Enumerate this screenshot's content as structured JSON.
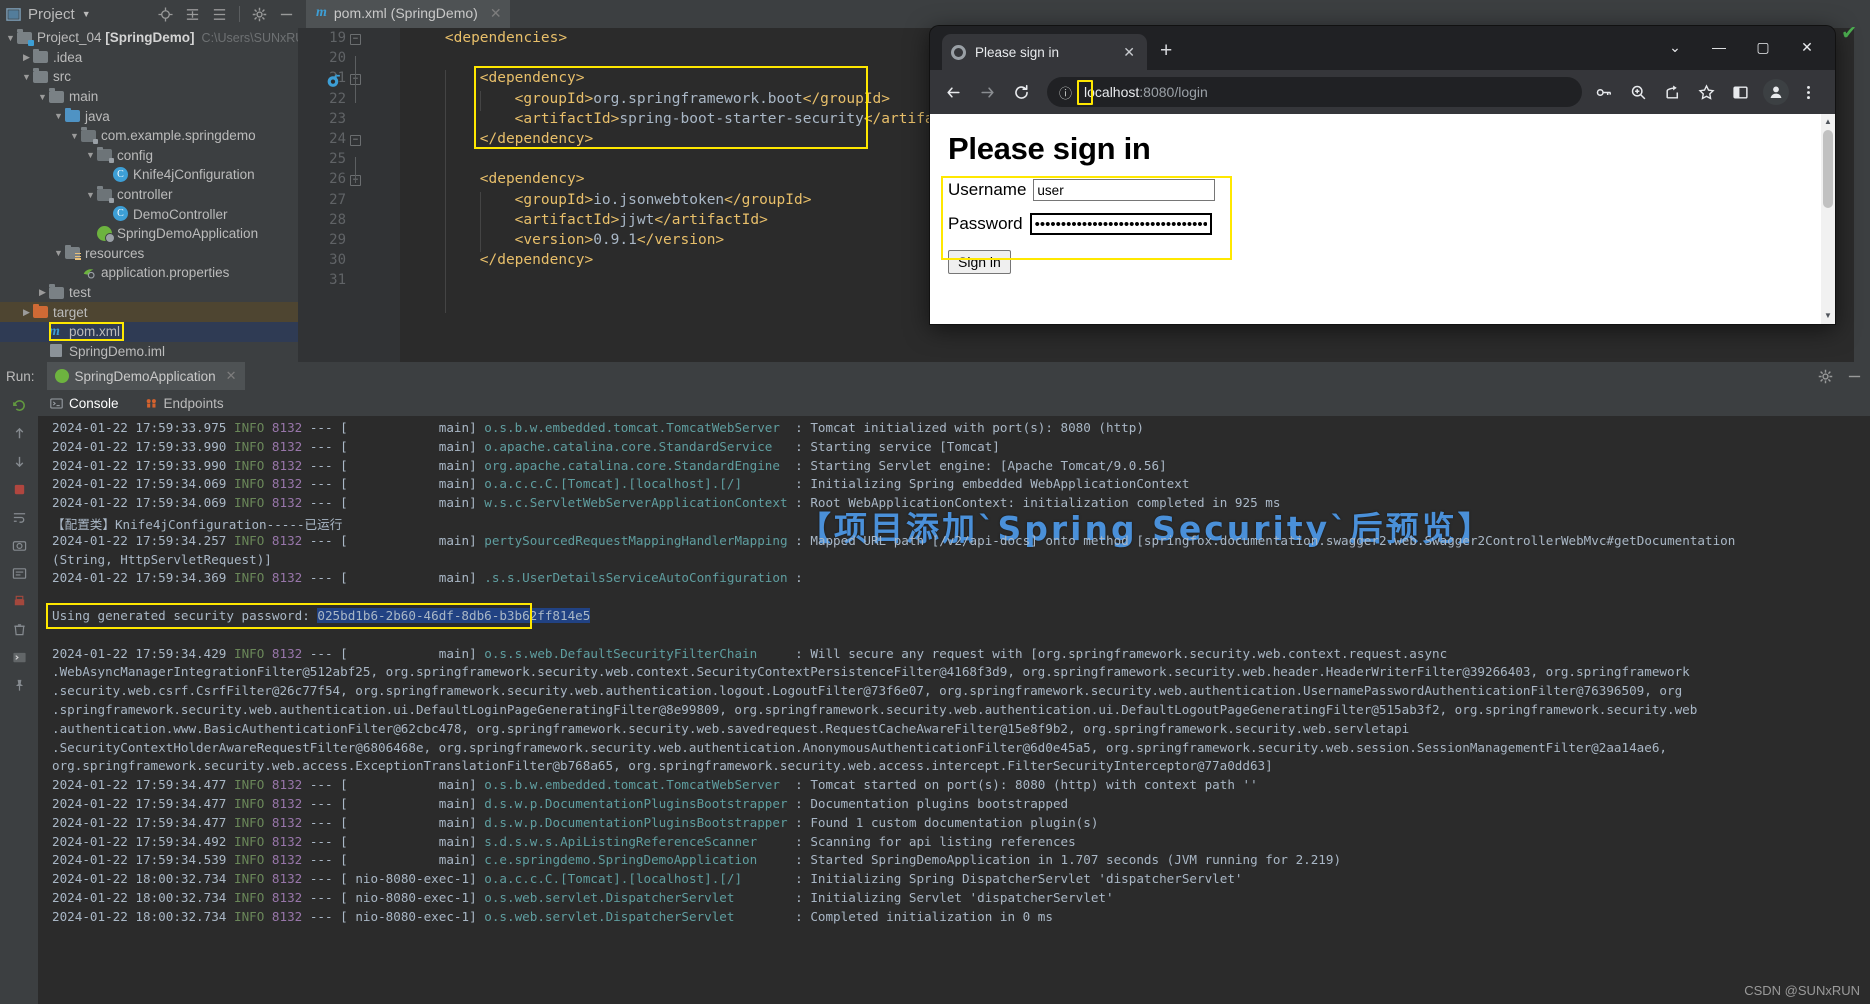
{
  "ide": {
    "project_panel": {
      "title": "Project",
      "caret": "▼",
      "icons": [
        "locate-icon",
        "expand-all-icon",
        "collapse-all-icon",
        "settings-icon",
        "minimize-icon"
      ]
    },
    "tree": [
      {
        "indent": 0,
        "arrow": "v",
        "icon": "module-folder",
        "label": "Project_04 ",
        "bold": "[SpringDemo]",
        "dim": "C:\\Users\\SUNxRUI"
      },
      {
        "indent": 1,
        "arrow": ">",
        "icon": "folder",
        "label": ".idea",
        "bold": "",
        "dim": ""
      },
      {
        "indent": 1,
        "arrow": "v",
        "icon": "folder",
        "label": "src",
        "bold": "",
        "dim": ""
      },
      {
        "indent": 2,
        "arrow": "v",
        "icon": "folder",
        "label": "main",
        "bold": "",
        "dim": ""
      },
      {
        "indent": 3,
        "arrow": "v",
        "icon": "folder-blue",
        "label": "java",
        "bold": "",
        "dim": ""
      },
      {
        "indent": 4,
        "arrow": "v",
        "icon": "package",
        "label": "com.example.springdemo",
        "bold": "",
        "dim": ""
      },
      {
        "indent": 5,
        "arrow": "v",
        "icon": "package",
        "label": "config",
        "bold": "",
        "dim": ""
      },
      {
        "indent": 6,
        "arrow": "",
        "icon": "class",
        "label": "Knife4jConfiguration",
        "bold": "",
        "dim": ""
      },
      {
        "indent": 5,
        "arrow": "v",
        "icon": "package",
        "label": "controller",
        "bold": "",
        "dim": ""
      },
      {
        "indent": 6,
        "arrow": "",
        "icon": "class",
        "label": "DemoController",
        "bold": "",
        "dim": ""
      },
      {
        "indent": 5,
        "arrow": "",
        "icon": "spring",
        "label": "SpringDemoApplication",
        "bold": "",
        "dim": ""
      },
      {
        "indent": 3,
        "arrow": "v",
        "icon": "resources",
        "label": "resources",
        "bold": "",
        "dim": ""
      },
      {
        "indent": 4,
        "arrow": "",
        "icon": "properties",
        "label": "application.properties",
        "bold": "",
        "dim": ""
      },
      {
        "indent": 2,
        "arrow": ">",
        "icon": "folder",
        "label": "test",
        "bold": "",
        "dim": ""
      },
      {
        "indent": 1,
        "arrow": ">",
        "icon": "folder-orange",
        "label": "target",
        "bold": "",
        "dim": "",
        "selected": "amber"
      },
      {
        "indent": 2,
        "arrow": "",
        "icon": "maven",
        "label": "pom.xml",
        "bold": "",
        "dim": "",
        "selected": "blue",
        "highlight": true
      },
      {
        "indent": 2,
        "arrow": "",
        "icon": "iml",
        "label": "SpringDemo.iml",
        "bold": "",
        "dim": ""
      }
    ],
    "editor": {
      "tab": {
        "icon": "maven-m",
        "name": "pom.xml (SpringDemo)",
        "close": "✕"
      },
      "lines": [
        {
          "num": "19",
          "indent": 1,
          "segments": [
            {
              "t": "<dependencies>",
              "c": "tag"
            }
          ]
        },
        {
          "num": "20",
          "indent": 0,
          "segments": []
        },
        {
          "num": "21",
          "indent": 2,
          "segments": [
            {
              "t": "<dependency>",
              "c": "tag"
            }
          ]
        },
        {
          "num": "22",
          "indent": 3,
          "segments": [
            {
              "t": "<groupId>",
              "c": "tag"
            },
            {
              "t": "org.springframework.boot",
              "c": "txt"
            },
            {
              "t": "</groupId>",
              "c": "tag"
            }
          ]
        },
        {
          "num": "23",
          "indent": 3,
          "segments": [
            {
              "t": "<artifactId>",
              "c": "tag"
            },
            {
              "t": "spring-boot-starter-security",
              "c": "txt"
            },
            {
              "t": "</artifactId>",
              "c": "tag"
            }
          ]
        },
        {
          "num": "24",
          "indent": 2,
          "segments": [
            {
              "t": "</dependency>",
              "c": "tag"
            }
          ]
        },
        {
          "num": "25",
          "indent": 0,
          "segments": []
        },
        {
          "num": "26",
          "indent": 2,
          "segments": [
            {
              "t": "<dependency>",
              "c": "tag"
            }
          ]
        },
        {
          "num": "27",
          "indent": 3,
          "segments": [
            {
              "t": "<groupId>",
              "c": "tag"
            },
            {
              "t": "io.jsonwebtoken",
              "c": "txt"
            },
            {
              "t": "</groupId>",
              "c": "tag"
            }
          ]
        },
        {
          "num": "28",
          "indent": 3,
          "segments": [
            {
              "t": "<artifactId>",
              "c": "tag"
            },
            {
              "t": "jjwt",
              "c": "txt"
            },
            {
              "t": "</artifactId>",
              "c": "tag"
            }
          ]
        },
        {
          "num": "29",
          "indent": 3,
          "segments": [
            {
              "t": "<version>",
              "c": "tag"
            },
            {
              "t": "0.9.1",
              "c": "txt"
            },
            {
              "t": "</version>",
              "c": "tag"
            }
          ]
        },
        {
          "num": "30",
          "indent": 2,
          "segments": [
            {
              "t": "</dependency>",
              "c": "tag"
            }
          ]
        },
        {
          "num": "31",
          "indent": 0,
          "segments": []
        }
      ]
    },
    "run_panel": {
      "label": "Run:",
      "config_name": "SpringDemoApplication",
      "config_close": "✕",
      "tabs": [
        {
          "label": "Console",
          "icon": "console-icon",
          "active": true
        },
        {
          "label": "Endpoints",
          "icon": "endpoints-icon",
          "active": false
        }
      ],
      "right_icons": [
        "settings-icon",
        "minimize-icon"
      ]
    },
    "watermark": "【项目添加`Spring Security`后预览】",
    "credit": "CSDN @SUNxRUN"
  },
  "console_lines": [
    {
      "date": "2024-01-22 17:59:33.975",
      "level": "INFO",
      "pid": "8132",
      "thread": "main",
      "logger": "o.s.b.w.embedded.tomcat.TomcatWebServer",
      "msg": "Tomcat initialized with port(s): 8080 (http)"
    },
    {
      "date": "2024-01-22 17:59:33.990",
      "level": "INFO",
      "pid": "8132",
      "thread": "main",
      "logger": "o.apache.catalina.core.StandardService",
      "msg": "Starting service [Tomcat]"
    },
    {
      "date": "2024-01-22 17:59:33.990",
      "level": "INFO",
      "pid": "8132",
      "thread": "main",
      "logger": "org.apache.catalina.core.StandardEngine",
      "msg": "Starting Servlet engine: [Apache Tomcat/9.0.56]"
    },
    {
      "date": "2024-01-22 17:59:34.069",
      "level": "INFO",
      "pid": "8132",
      "thread": "main",
      "logger": "o.a.c.c.C.[Tomcat].[localhost].[/]",
      "msg": "Initializing Spring embedded WebApplicationContext"
    },
    {
      "date": "2024-01-22 17:59:34.069",
      "level": "INFO",
      "pid": "8132",
      "thread": "main",
      "logger": "w.s.c.ServletWebServerApplicationContext",
      "msg": "Root WebApplicationContext: initialization completed in 925 ms"
    },
    {
      "raw": "【配置类】Knife4jConfiguration-----已运行"
    },
    {
      "date": "2024-01-22 17:59:34.257",
      "level": "INFO",
      "pid": "8132",
      "thread": "main",
      "logger": "pertySourcedRequestMappingHandlerMapping",
      "msg": "Mapped URL path [/v2/api-docs] onto method [springfox.documentation.swagger2.web.Swagger2ControllerWebMvc#getDocumentation"
    },
    {
      "raw": "(String, HttpServletRequest)]"
    },
    {
      "date": "2024-01-22 17:59:34.369",
      "level": "INFO",
      "pid": "8132",
      "thread": "main",
      "logger": ".s.s.UserDetailsServiceAutoConfiguration",
      "msg": ""
    },
    {
      "raw": ""
    },
    {
      "password_line": true,
      "prefix": "Using generated security password: ",
      "password": "025bd1b6-2b60-46df-8db6-b3b62ff814e5"
    },
    {
      "raw": ""
    },
    {
      "date": "2024-01-22 17:59:34.429",
      "level": "INFO",
      "pid": "8132",
      "thread": "main",
      "logger": "o.s.s.web.DefaultSecurityFilterChain",
      "msg": "Will secure any request with [org.springframework.security.web.context.request.async"
    },
    {
      "raw": ".WebAsyncManagerIntegrationFilter@512abf25, org.springframework.security.web.context.SecurityContextPersistenceFilter@4168f3d9, org.springframework.security.web.header.HeaderWriterFilter@39266403, org.springframework"
    },
    {
      "raw": ".security.web.csrf.CsrfFilter@26c77f54, org.springframework.security.web.authentication.logout.LogoutFilter@73f6e07, org.springframework.security.web.authentication.UsernamePasswordAuthenticationFilter@76396509, org"
    },
    {
      "raw": ".springframework.security.web.authentication.ui.DefaultLoginPageGeneratingFilter@8e99809, org.springframework.security.web.authentication.ui.DefaultLogoutPageGeneratingFilter@515ab3f2, org.springframework.security.web"
    },
    {
      "raw": ".authentication.www.BasicAuthenticationFilter@62cbc478, org.springframework.security.web.savedrequest.RequestCacheAwareFilter@15e8f9b2, org.springframework.security.web.servletapi"
    },
    {
      "raw": ".SecurityContextHolderAwareRequestFilter@6806468e, org.springframework.security.web.authentication.AnonymousAuthenticationFilter@6d0e45a5, org.springframework.security.web.session.SessionManagementFilter@2aa14ae6,"
    },
    {
      "raw": "org.springframework.security.web.access.ExceptionTranslationFilter@b768a65, org.springframework.security.web.access.intercept.FilterSecurityInterceptor@77a0dd63]"
    },
    {
      "date": "2024-01-22 17:59:34.477",
      "level": "INFO",
      "pid": "8132",
      "thread": "main",
      "logger": "o.s.b.w.embedded.tomcat.TomcatWebServer",
      "msg": "Tomcat started on port(s): 8080 (http) with context path ''"
    },
    {
      "date": "2024-01-22 17:59:34.477",
      "level": "INFO",
      "pid": "8132",
      "thread": "main",
      "logger": "d.s.w.p.DocumentationPluginsBootstrapper",
      "msg": "Documentation plugins bootstrapped"
    },
    {
      "date": "2024-01-22 17:59:34.477",
      "level": "INFO",
      "pid": "8132",
      "thread": "main",
      "logger": "d.s.w.p.DocumentationPluginsBootstrapper",
      "msg": "Found 1 custom documentation plugin(s)"
    },
    {
      "date": "2024-01-22 17:59:34.492",
      "level": "INFO",
      "pid": "8132",
      "thread": "main",
      "logger": "s.d.s.w.s.ApiListingReferenceScanner",
      "msg": "Scanning for api listing references"
    },
    {
      "date": "2024-01-22 17:59:34.539",
      "level": "INFO",
      "pid": "8132",
      "thread": "main",
      "logger": "c.e.springdemo.SpringDemoApplication",
      "msg": "Started SpringDemoApplication in 1.707 seconds (JVM running for 2.219)"
    },
    {
      "date": "2024-01-22 18:00:32.734",
      "level": "INFO",
      "pid": "8132",
      "thread": "nio-8080-exec-1",
      "logger": "o.a.c.c.C.[Tomcat].[localhost].[/]",
      "msg": "Initializing Spring DispatcherServlet 'dispatcherServlet'"
    },
    {
      "date": "2024-01-22 18:00:32.734",
      "level": "INFO",
      "pid": "8132",
      "thread": "nio-8080-exec-1",
      "logger": "o.s.web.servlet.DispatcherServlet",
      "msg": "Initializing Servlet 'dispatcherServlet'"
    },
    {
      "date": "2024-01-22 18:00:32.734",
      "level": "INFO",
      "pid": "8132",
      "thread": "nio-8080-exec-1",
      "logger": "o.s.web.servlet.DispatcherServlet",
      "msg": "Completed initialization in 0 ms"
    }
  ],
  "browser": {
    "tab": {
      "title": "Please sign in",
      "close": "✕"
    },
    "new_tab": "+",
    "window_buttons": [
      "⌄",
      "—",
      "▢",
      "✕"
    ],
    "nav": {
      "back": "←",
      "forward": "→",
      "reload": "⟳"
    },
    "omnibox": {
      "info_icon": "ⓘ",
      "host": "localhost",
      "rest": ":8080/login"
    },
    "toolbar_icons": [
      "key-icon",
      "zoom-icon",
      "share-icon",
      "bookmark-star-icon",
      "sidepanel-icon",
      "profile-icon",
      "menu-kebab-icon"
    ],
    "page": {
      "heading": "Please sign in",
      "username_label": "Username",
      "username_value": "user",
      "password_label": "Password",
      "password_value": "••••••••••••••••••••••••••••••••••",
      "submit_label": "Sign in"
    }
  },
  "colors": {
    "ide_bg": "#3c3f41",
    "editor_bg": "#2b2b2b",
    "highlight_yellow": "#ffe800",
    "accent_blue": "#3d9fd6",
    "spring_green": "#6db33f",
    "selection_blue": "#214283",
    "watermark_blue": "#4a90d9"
  }
}
